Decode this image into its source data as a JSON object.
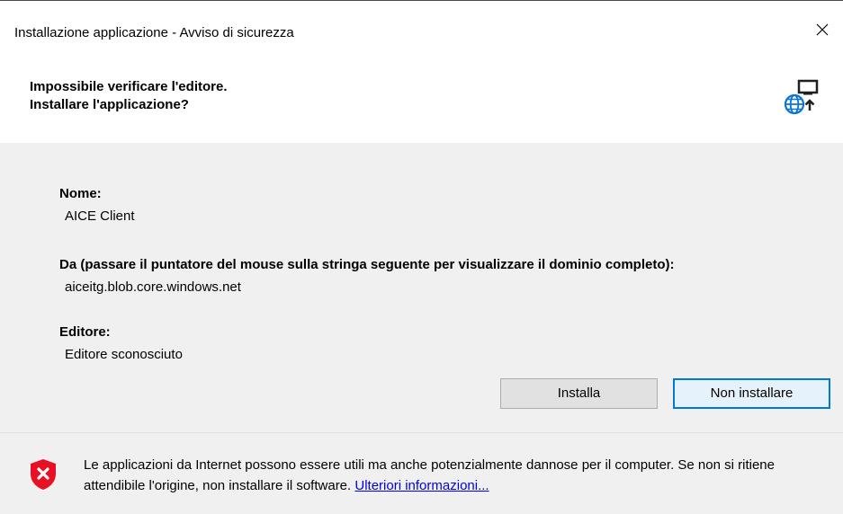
{
  "window": {
    "title": "Installazione applicazione - Avviso di sicurezza",
    "close_glyph": "✕"
  },
  "header": {
    "line1": "Impossibile verificare l'editore.",
    "line2": "Installare l'applicazione?",
    "icon": "globe-install-icon"
  },
  "details": {
    "name_label": "Nome:",
    "name_value": "AICE Client",
    "from_label": "Da (passare il puntatore del mouse sulla stringa seguente per visualizzare il dominio completo):",
    "from_value": "aiceitg.blob.core.windows.net",
    "publisher_label": "Editore:",
    "publisher_value": "Editore sconosciuto"
  },
  "buttons": {
    "install": "Installa",
    "dont_install": "Non installare"
  },
  "footer": {
    "warning_icon": "shield-error-icon",
    "text": "Le applicazioni da Internet possono essere utili ma anche potenzialmente dannose per il computer. Se non si ritiene attendibile l'origine, non installare il software. ",
    "link": "Ulteriori informazioni..."
  },
  "colors": {
    "accent": "#0078d7",
    "panel": "#f0f0f0",
    "shield": "#e81123",
    "link": "#0000ee"
  }
}
